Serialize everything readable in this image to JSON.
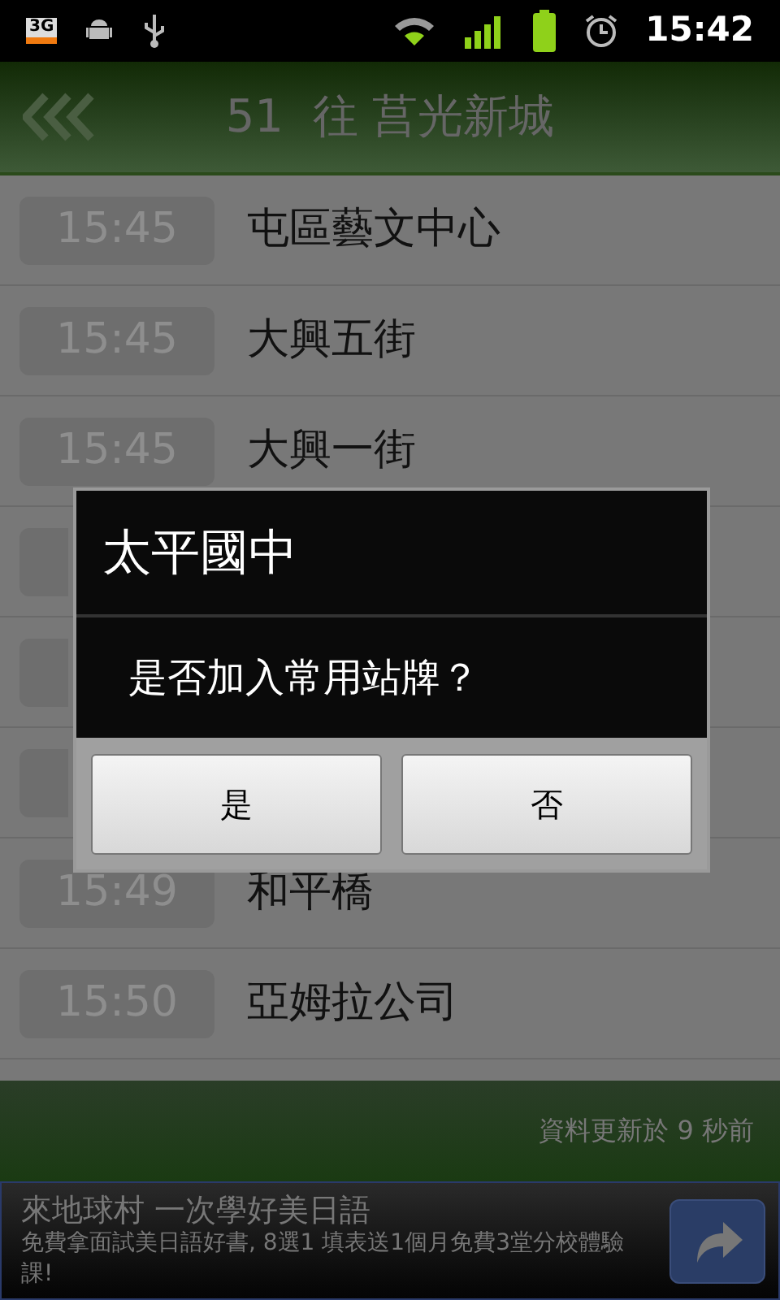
{
  "status_bar": {
    "network": "3G",
    "time": "15:42"
  },
  "header": {
    "title": "51  往 莒光新城"
  },
  "rows": [
    {
      "kind": "stop",
      "time": "15:45",
      "stop": "屯區藝文中心"
    },
    {
      "kind": "stop",
      "time": "15:45",
      "stop": "大興五街"
    },
    {
      "kind": "stop",
      "time": "15:45",
      "stop": "大興一街"
    },
    {
      "kind": "covered"
    },
    {
      "kind": "covered"
    },
    {
      "kind": "covered"
    },
    {
      "kind": "stop",
      "time": "15:49",
      "stop": "和平橋"
    },
    {
      "kind": "stop",
      "time": "15:50",
      "stop": "亞姆拉公司"
    }
  ],
  "footer": {
    "updated": "資料更新於 9 秒前"
  },
  "ad": {
    "headline": "來地球村 一次學好美日語",
    "body": "免費拿面試美日語好書, 8選1 填表送1個月免費3堂分校體驗課!"
  },
  "dialog": {
    "title": "太平國中",
    "message": "是否加入常用站牌？",
    "buttons": [
      "是",
      "否"
    ]
  }
}
